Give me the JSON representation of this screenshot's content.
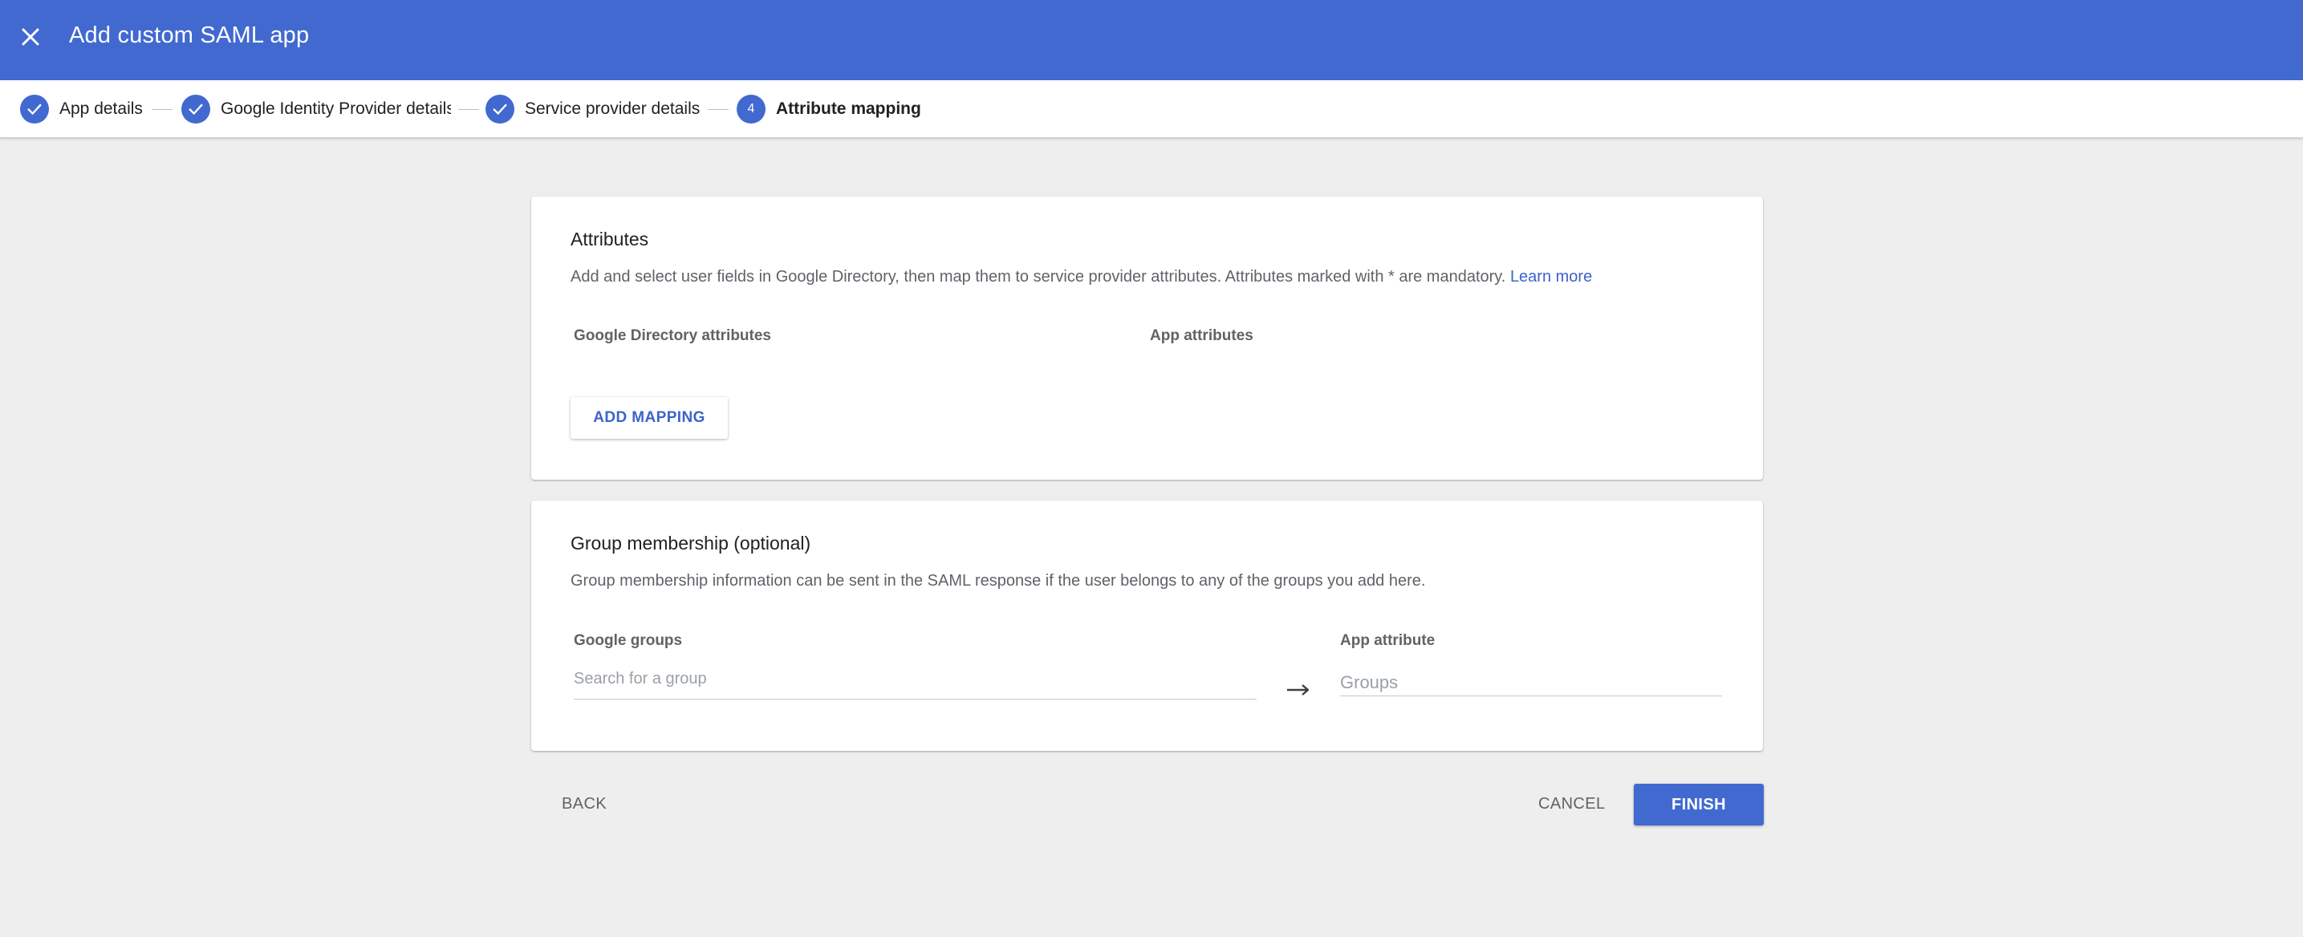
{
  "header": {
    "title": "Add custom SAML app",
    "close_icon": "close-icon"
  },
  "stepper": {
    "steps": [
      {
        "label": "App details",
        "state": "completed",
        "icon": "check-icon"
      },
      {
        "label": "Google Identity Provider details",
        "state": "completed",
        "icon": "check-icon"
      },
      {
        "label": "Service provider details",
        "state": "completed",
        "icon": "check-icon"
      },
      {
        "label": "Attribute mapping",
        "state": "active",
        "number": "4"
      }
    ]
  },
  "attributes_card": {
    "title": "Attributes",
    "description": "Add and select user fields in Google Directory, then map them to service provider attributes. Attributes marked with * are mandatory.",
    "learn_more": "Learn more",
    "col_directory": "Google Directory attributes",
    "col_app": "App attributes",
    "add_mapping_label": "ADD MAPPING"
  },
  "group_card": {
    "title": "Group membership (optional)",
    "description": "Group membership information can be sent in the SAML response if the user belongs to any of the groups you add here.",
    "col_groups": "Google groups",
    "search_placeholder": "Search for a group",
    "arrow_icon": "arrow-right-icon",
    "col_app_attribute": "App attribute",
    "app_attribute_placeholder": "Groups"
  },
  "footer": {
    "back_label": "BACK",
    "cancel_label": "CANCEL",
    "finish_label": "FINISH"
  },
  "colors": {
    "primary": "#4169d0",
    "link": "#3c64c8",
    "background": "#eeeeee"
  }
}
